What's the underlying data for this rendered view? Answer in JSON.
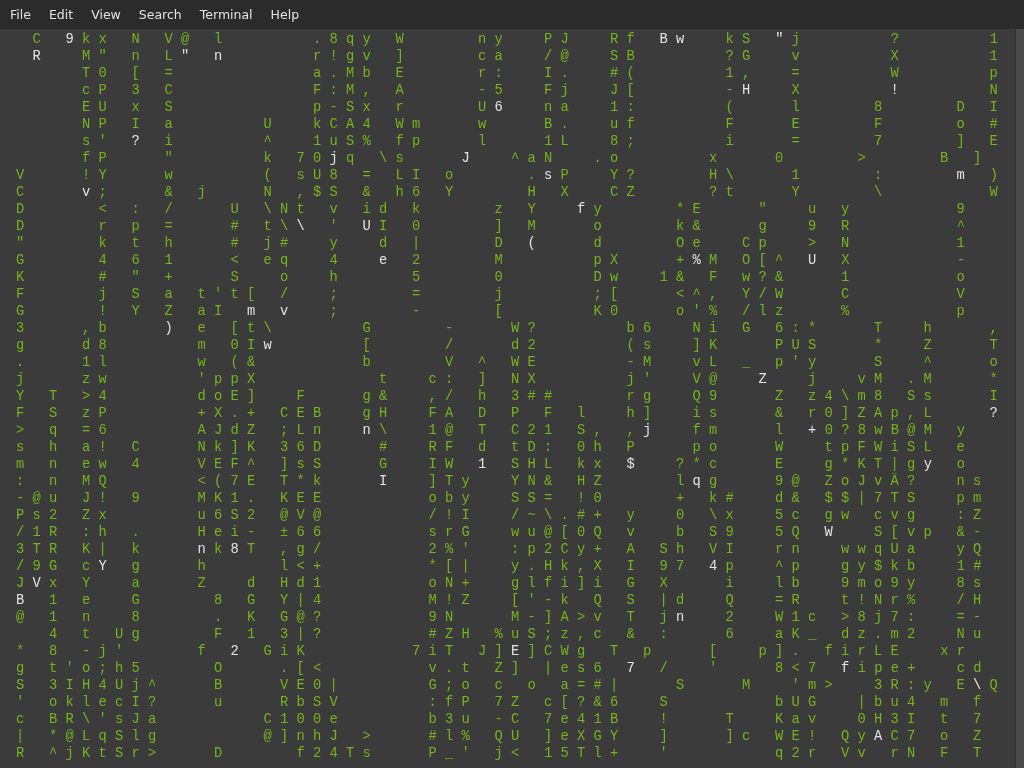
{
  "menu": [
    "File",
    "Edit",
    "View",
    "Search",
    "Terminal",
    "Help"
  ],
  "rows": [
    [
      {
        "text": " C ",
        "head": false
      },
      {
        "text": "9",
        "head": true
      },
      {
        "text": "kx N V@ l     .8qy W    ny  PJ  Rf ",
        "head": false
      },
      {
        "text": "Bw",
        "head": true
      },
      {
        "text": "  kS ",
        "head": false
      },
      {
        "text": "\"",
        "head": true
      },
      {
        "text": "j     ?     1",
        "head": false
      }
    ],
    [
      {
        "text": " R",
        "head": true
      },
      {
        "text": "  M\" n L",
        "head": false
      },
      {
        "text": "\" n",
        "head": true
      },
      {
        "text": "     r!gv ]    ca  /@  SB     ?G  v     X     1",
        "head": false
      }
    ],
    [
      {
        "text": "    T0 [ =        a.Mb E    r:  I.  #(     1,  =     W     p",
        "head": false
      }
    ],
    [
      {
        "text": "    cP 3 C        F:M, A    -5  Fj  J[     -",
        "head": false
      },
      {
        "text": "H",
        "head": true
      },
      {
        "text": "  X     ",
        "head": false
      },
      {
        "text": "!",
        "head": true
      },
      {
        "text": "     N",
        "head": false
      }
    ],
    [
      {
        "text": "    EU x S        p-Sx r    U",
        "head": false
      },
      {
        "text": "6",
        "head": true
      },
      {
        "text": "  na  1:     (   l    8    D I",
        "head": false
      }
    ],
    [
      {
        "text": "    NP I a     U  kCA4 Wm   w   B.  uf     F   E    F    o #",
        "head": false
      }
    ],
    [
      {
        "text": "    s' ",
        "head": false
      },
      {
        "text": "?",
        "head": true
      },
      {
        "text": " i     ^  1uS% fp   l   1L  8;     i   =    7    ] E",
        "head": false
      }
    ],
    [
      {
        "text": "    fP   \"     k 70",
        "head": false
      },
      {
        "text": "j",
        "head": true
      },
      {
        "text": "q \\s   ",
        "head": false
      },
      {
        "text": "J",
        "head": true
      },
      {
        "text": "  ^aN  .o     x   0    >    B ]",
        "head": false
      }
    ],
    [
      {
        "text": "V   !Y   w     ( sU8 = LI o    .",
        "head": false
      },
      {
        "text": "s",
        "head": true
      },
      {
        "text": "P  Y?    H\\   1    :    ",
        "head": false
      },
      {
        "text": "m",
        "head": true
      },
      {
        "text": " )",
        "head": false
      }
    ],
    [
      {
        "text": "C   ",
        "head": false
      },
      {
        "text": "v",
        "head": true
      },
      {
        "text": ";   & j   N ,$S & h6 Y    H X  CZ    ?t   Y    \\      W",
        "head": false
      }
    ],
    [
      {
        "text": "D    < : /   U \\Nt v id k    z Y  ",
        "head": false
      },
      {
        "text": "f",
        "head": true
      },
      {
        "text": "y    *E   \"  u y      9",
        "head": false
      }
    ],
    [
      {
        "text": "D    r p =   # t\\",
        "head": false
      },
      {
        "text": "\\",
        "head": true
      },
      {
        "text": " ' ",
        "head": false
      },
      {
        "text": "U",
        "head": true
      },
      {
        "text": "I 0    ] M   o    k&   g  9 R      ^",
        "head": false
      }
    ],
    [
      {
        "text": "\"    k t h   # j#  y  d |    D ",
        "head": false
      },
      {
        "text": "(",
        "head": true
      },
      {
        "text": "   d    Oe  Cp  > N      1",
        "head": false
      }
    ],
    [
      {
        "text": "G    4 6 1   < eq  4  ",
        "head": false
      },
      {
        "text": "e",
        "head": true
      },
      {
        "text": " 2    M     pX   +",
        "head": false
      },
      {
        "text": "%",
        "head": true
      },
      {
        "text": "M O[^ ",
        "head": false
      },
      {
        "text": "U",
        "head": true
      },
      {
        "text": " X      -",
        "head": false
      }
    ],
    [
      {
        "text": "K    # \" +   S  o  h    5    0     Dw  1& F w?&   1      o",
        "head": false
      }
    ],
    [
      {
        "text": "F    j S a t't[ /  ;    =    j     ;[   <^, Y/W   C      V",
        "head": false
      }
    ],
    [
      {
        "text": "G    ! Y Z aI ",
        "head": false
      },
      {
        "text": "m v",
        "head": true
      },
      {
        "text": "  ;    -    [     K0   o'% /lz   %      p",
        "head": false
      }
    ],
    [
      {
        "text": "3   ,b   ",
        "head": false
      },
      {
        "text": ")",
        "head": true
      },
      {
        "text": " e [t\\     G    -   W?     b6  Ni G 6:*   T  h   ,",
        "head": false
      }
    ],
    [
      {
        "text": "g   d8     m 0I",
        "head": false
      },
      {
        "text": "w",
        "head": true
      },
      {
        "text": "     [    /   d2     (s  ]K   PUS   *  Z   T",
        "head": false
      }
    ],
    [
      {
        "text": ".   1l     w (&      b    V ^ WE     -M  vL _ p'y   S  ^   o",
        "head": false
      }
    ],
    [
      {
        "text": "j   zw     'ppX       t  c: ] NX     j'  V@  ",
        "head": false
      },
      {
        "text": "Z",
        "head": true
      },
      {
        "text": "  j  vM .M   *",
        "head": false
      }
    ],
    [
      {
        "text": "Y T >4     doE]  F   g&  ,/ h 3##    rg  Q9   Z z4\\m8 Ss   I",
        "head": false
      }
    ],
    [
      {
        "text": "F S zP     +X.+ CEB  gH  FA D P F l  h]  is   & r0]ZAp,L   ",
        "head": false
      },
      {
        "text": "?",
        "head": true
      }
    ],
    [
      {
        "text": "> q =6     AJdZ ;Ln  ",
        "head": false
      },
      {
        "text": "n",
        "head": true
      },
      {
        "text": "\\  1@ T C21 S, ,",
        "head": false
      },
      {
        "text": "j",
        "head": true
      },
      {
        "text": "  fm   l ",
        "head": false
      },
      {
        "text": "+",
        "head": true
      },
      {
        "text": "0?8wB@M y",
        "head": false
      }
    ],
    [
      {
        "text": "s h a! C   Nk]K 36D   #  RF d tD: 0h P   po   W  tpFWiSL e",
        "head": false
      }
    ],
    [
      {
        "text": "m n ew 4   VEF^ ]sS   G  IW ",
        "head": false
      },
      {
        "text": "1",
        "head": true
      },
      {
        "text": " SHL kx ",
        "head": false
      },
      {
        "text": "$",
        "head": true
      },
      {
        "text": "  ?*c   E  g*KT|g",
        "head": false
      },
      {
        "text": "y",
        "head": true
      },
      {
        "text": " o",
        "head": false
      }
    ],
    [
      {
        "text": ": n MQ     <(7E T*k   ",
        "head": false
      },
      {
        "text": "I",
        "head": true
      },
      {
        "text": "  ]Ty  YN& HZ    l",
        "head": false
      },
      {
        "text": "q",
        "head": true
      },
      {
        "text": "g   9@ ZoJvÄ?  ns",
        "head": false
      }
    ],
    [
      {
        "text": "-@u J! 9   MK1. KEE      oby  SS= !0    + k#  d& $$|7TS  pm",
        "head": false
      }
    ],
    [
      {
        "text": "Ps2 Zx     u6S2 @V@      /!I  /~\\.#+ y  0 \\x  5c gw cvg  :Z",
        "head": false
      }
    ],
    [
      {
        "text": "/1R :h .   Hei- ±66      srG  wu@[0Q v  b S9  5Q ",
        "head": false
      },
      {
        "text": "W",
        "head": true
      },
      {
        "text": "  S[vp &-",
        "head": false
      }
    ],
    [
      {
        "text": "3TR K| k   ",
        "head": false
      },
      {
        "text": "n",
        "head": true
      },
      {
        "text": "k",
        "head": false
      },
      {
        "text": "8",
        "head": true
      },
      {
        "text": "T ,g/      2%'  :p2Cy+ A Sh VI  rn  wwqUa  yQ",
        "head": false
      }
    ],
    [
      {
        "text": "/9G c",
        "head": false
      },
      {
        "text": "Y",
        "head": true
      },
      {
        "text": " g   h    l<+      *[|  y.Hk,X I 97 ",
        "head": false
      },
      {
        "text": "4",
        "head": true
      },
      {
        "text": "p  ^p  gy$kb  1#",
        "head": false
      }
    ],
    [
      {
        "text": "J",
        "head": false
      },
      {
        "text": "V",
        "head": true
      },
      {
        "text": "x Y  a   Z  d Hd1      oN+  glfi]i G X   i  lb  9mo9y  8s",
        "head": false
      }
    ],
    [
      {
        "text": "B",
        "head": true
      },
      {
        "text": " 1 e  G    8 G Y|4      M!Z  ['-k Q S |d  Q  =R  t!Nr%  /H",
        "head": false
      }
    ],
    [
      {
        "text": "@ 1 n  8    . K G@?      9N   M-]A>v T j",
        "head": false
      },
      {
        "text": "n",
        "head": true
      },
      {
        "text": "  2  W1c >8j7:  =-",
        "head": false
      }
    ],
    [
      {
        "text": "  4 t Ug    F 1 3|?      #ZH %uS;z,c & :   6  aK_ dz.m2  Nu",
        "head": false
      }
    ],
    [
      {
        "text": "* 8 -j'    f ",
        "head": false
      },
      {
        "text": "2",
        "head": true
      },
      {
        "text": " GiK      7iT J]",
        "head": false
      },
      {
        "text": "E",
        "head": true
      },
      {
        "text": "]CWg T p   [  p]. firLE  xr",
        "head": false
      }
    ],
    [
      {
        "text": "g t'o;h5    O   .[<      v.t Z] |es6 ",
        "head": false
      },
      {
        "text": "7",
        "head": true
      },
      {
        "text": " /  '   8<7 ",
        "head": false
      },
      {
        "text": "f",
        "head": true
      },
      {
        "text": "ipe+  cd",
        "head": false
      }
    ],
    [
      {
        "text": "S 3IH4Uj^   B   VE0|     G;o c o a=#|   S   M  'm>  3R:y E",
        "head": false
      },
      {
        "text": "\\",
        "head": true
      },
      {
        "text": "Q",
        "head": false
      }
    ],
    [
      {
        "text": "' oklecI?   u   RbSV     :fP 7Z c[?&6  S      bUG  |bu4 m f",
        "head": false
      }
    ],
    [
      {
        "text": "c BR\\'sJa      C100e     b3u -C 7e41B  !   T  Kav  0H3I t 7",
        "head": false
      }
    ],
    [
      {
        "text": "| *@LqSlg      @]nhJ >   #l% QU ]eXGY  ]   ]c WE! Qy",
        "head": false
      },
      {
        "text": "A",
        "head": true
      },
      {
        "text": "C7 o Z",
        "head": false
      }
    ],
    [
      {
        "text": "R ^jKtSr>   D    f24Ts   P_' j< 15Tl+  '      q2r Vv rN F T",
        "head": false
      }
    ]
  ]
}
